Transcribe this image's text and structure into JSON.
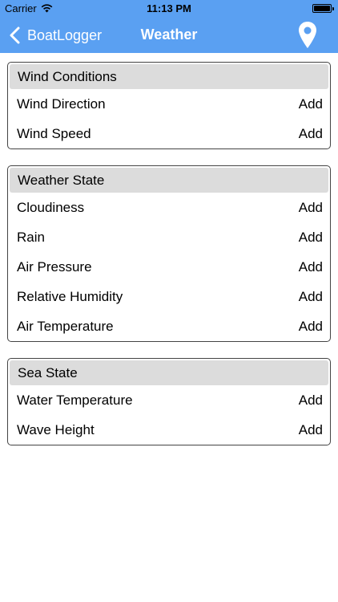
{
  "status_bar": {
    "carrier": "Carrier",
    "time": "11:13 PM",
    "wifi_icon": "wifi-icon",
    "battery_icon": "battery-icon"
  },
  "nav": {
    "back_label": "BoatLogger",
    "title": "Weather",
    "back_icon": "chevron-left-icon",
    "location_icon": "map-pin-icon",
    "bar_color": "#5aa0f2"
  },
  "sections": [
    {
      "title": "Wind Conditions",
      "rows": [
        {
          "label": "Wind Direction",
          "action": "Add"
        },
        {
          "label": "Wind Speed",
          "action": "Add"
        }
      ]
    },
    {
      "title": "Weather State",
      "rows": [
        {
          "label": "Cloudiness",
          "action": "Add"
        },
        {
          "label": "Rain",
          "action": "Add"
        },
        {
          "label": "Air Pressure",
          "action": "Add"
        },
        {
          "label": "Relative Humidity",
          "action": "Add"
        },
        {
          "label": "Air Temperature",
          "action": "Add"
        }
      ]
    },
    {
      "title": "Sea State",
      "rows": [
        {
          "label": "Water Temperature",
          "action": "Add"
        },
        {
          "label": "Wave Height",
          "action": "Add"
        }
      ]
    }
  ]
}
